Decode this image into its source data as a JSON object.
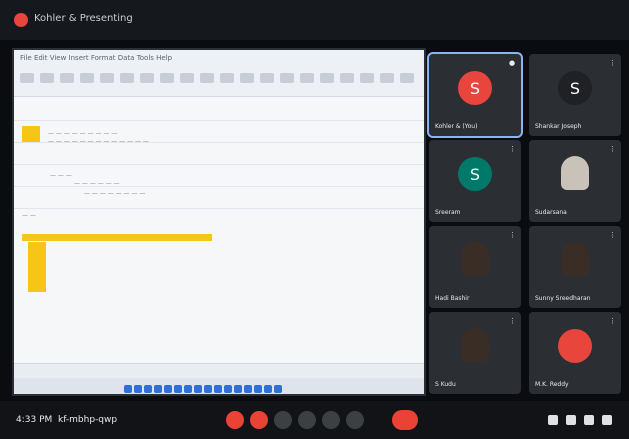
{
  "meeting": {
    "title": "Kohler & Presenting",
    "time": "4:33 PM",
    "code": "kf-mbhp-qwp"
  },
  "shared_screen": {
    "app_label": "Spreadsheet",
    "tab_text": "File  Edit  View  Insert  Format  Data  Tools  Help"
  },
  "participants": [
    {
      "name": "Kohler & (You)",
      "initial": "S",
      "color": "#e8453c",
      "kind": "avatar"
    },
    {
      "name": "Shankar Joseph",
      "initial": "S",
      "color": "#1f2125",
      "kind": "avatar"
    },
    {
      "name": "Sreeram",
      "initial": "S",
      "color": "#00796b",
      "kind": "avatar"
    },
    {
      "name": "Sudarsana",
      "initial": "",
      "color": "",
      "kind": "photo-light"
    },
    {
      "name": "Hadi Bashir",
      "initial": "",
      "color": "",
      "kind": "photo"
    },
    {
      "name": "Sunny Sreedharan",
      "initial": "",
      "color": "",
      "kind": "photo"
    },
    {
      "name": "S Kudu",
      "initial": "",
      "color": "",
      "kind": "photo"
    },
    {
      "name": "M.K. Reddy",
      "initial": "",
      "color": "#e8453c",
      "kind": "avatar-blank"
    }
  ],
  "icons": {
    "mic": "mic-icon",
    "camera": "camera-icon",
    "present": "present-icon",
    "hand": "raise-hand-icon",
    "more": "more-options-icon",
    "hangup": "hangup-icon",
    "info": "info-icon",
    "people": "people-icon",
    "chat": "chat-icon",
    "activities": "activities-icon"
  }
}
